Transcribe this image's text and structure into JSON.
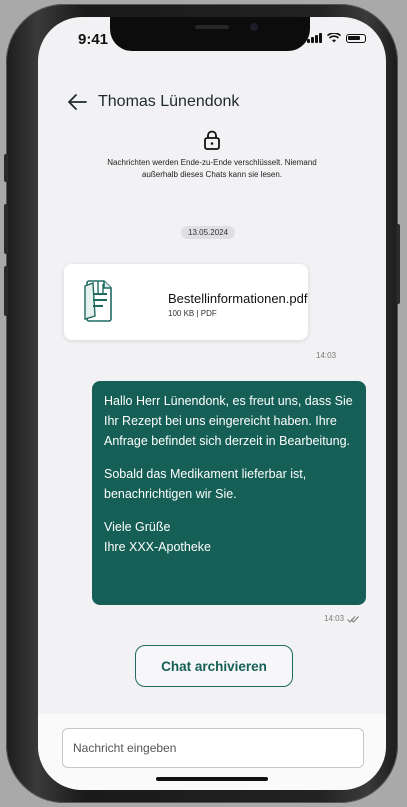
{
  "status_bar": {
    "time": "9:41"
  },
  "header": {
    "contact_name": "Thomas Lünendonk"
  },
  "encryption_notice": {
    "text": "Nachrichten werden Ende-zu-Ende verschlüsselt. Niemand außerhalb dieses Chats kann sie lesen."
  },
  "date_badge": "13.05.2024",
  "messages": [
    {
      "type": "file",
      "file_name": "Bestellinformationen.pdf",
      "file_meta": "100 KB | PDF",
      "time": "14:03"
    },
    {
      "type": "text",
      "paragraphs": [
        "Hallo Herr Lünendonk, es freut uns, dass Sie Ihr Rezept bei uns eingereicht haben. Ihre Anfrage befindet sich derzeit in Bearbeitung.",
        "Sobald das Medikament lieferbar ist, benachrichtigen wir Sie.",
        "Viele Grüße",
        "Ihre XXX-Apotheke"
      ],
      "time": "14:03"
    }
  ],
  "archive_button": "Chat archivieren",
  "input": {
    "placeholder": "Nachricht eingeben",
    "value": ""
  },
  "icons": {
    "back": "arrow-left-icon",
    "lock": "lock-icon",
    "file": "pdf-file-icon",
    "read_receipt": "double-check-icon"
  },
  "colors": {
    "accent": "#155f56",
    "background": "#f2f2f4"
  }
}
